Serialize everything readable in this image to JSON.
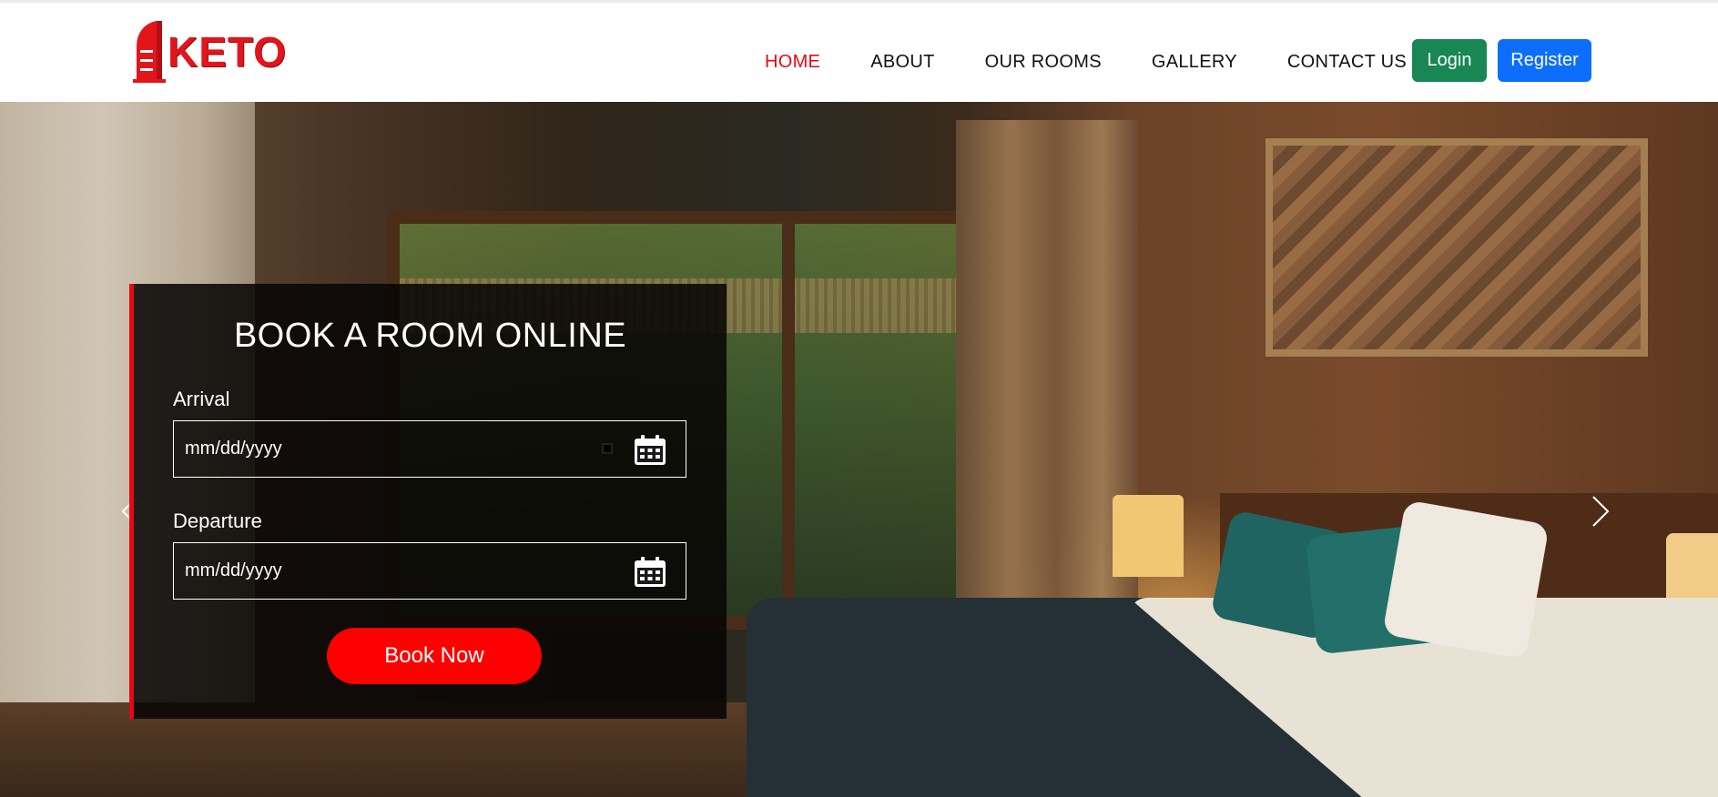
{
  "brand": {
    "name": "KETO",
    "icon": "hotel-tower-icon",
    "color": "#e3151b"
  },
  "nav": {
    "items": [
      {
        "label": "HOME",
        "active": true
      },
      {
        "label": "ABOUT",
        "active": false
      },
      {
        "label": "OUR ROOMS",
        "active": false
      },
      {
        "label": "GALLERY",
        "active": false
      },
      {
        "label": "CONTACT US",
        "active": false
      }
    ],
    "active_color": "#e50914"
  },
  "auth": {
    "login_label": "Login",
    "login_color": "#198754",
    "register_label": "Register",
    "register_color": "#0d6efd"
  },
  "booking": {
    "title": "BOOK A ROOM ONLINE",
    "arrival_label": "Arrival",
    "arrival_placeholder": "mm/dd/yyyy",
    "departure_label": "Departure",
    "departure_placeholder": "mm/dd/yyyy",
    "submit_label": "Book Now",
    "submit_color": "#ff0000",
    "accent_color": "#e50914"
  },
  "carousel": {
    "prev_icon": "chevron-left-icon",
    "next_icon": "chevron-right-icon"
  }
}
